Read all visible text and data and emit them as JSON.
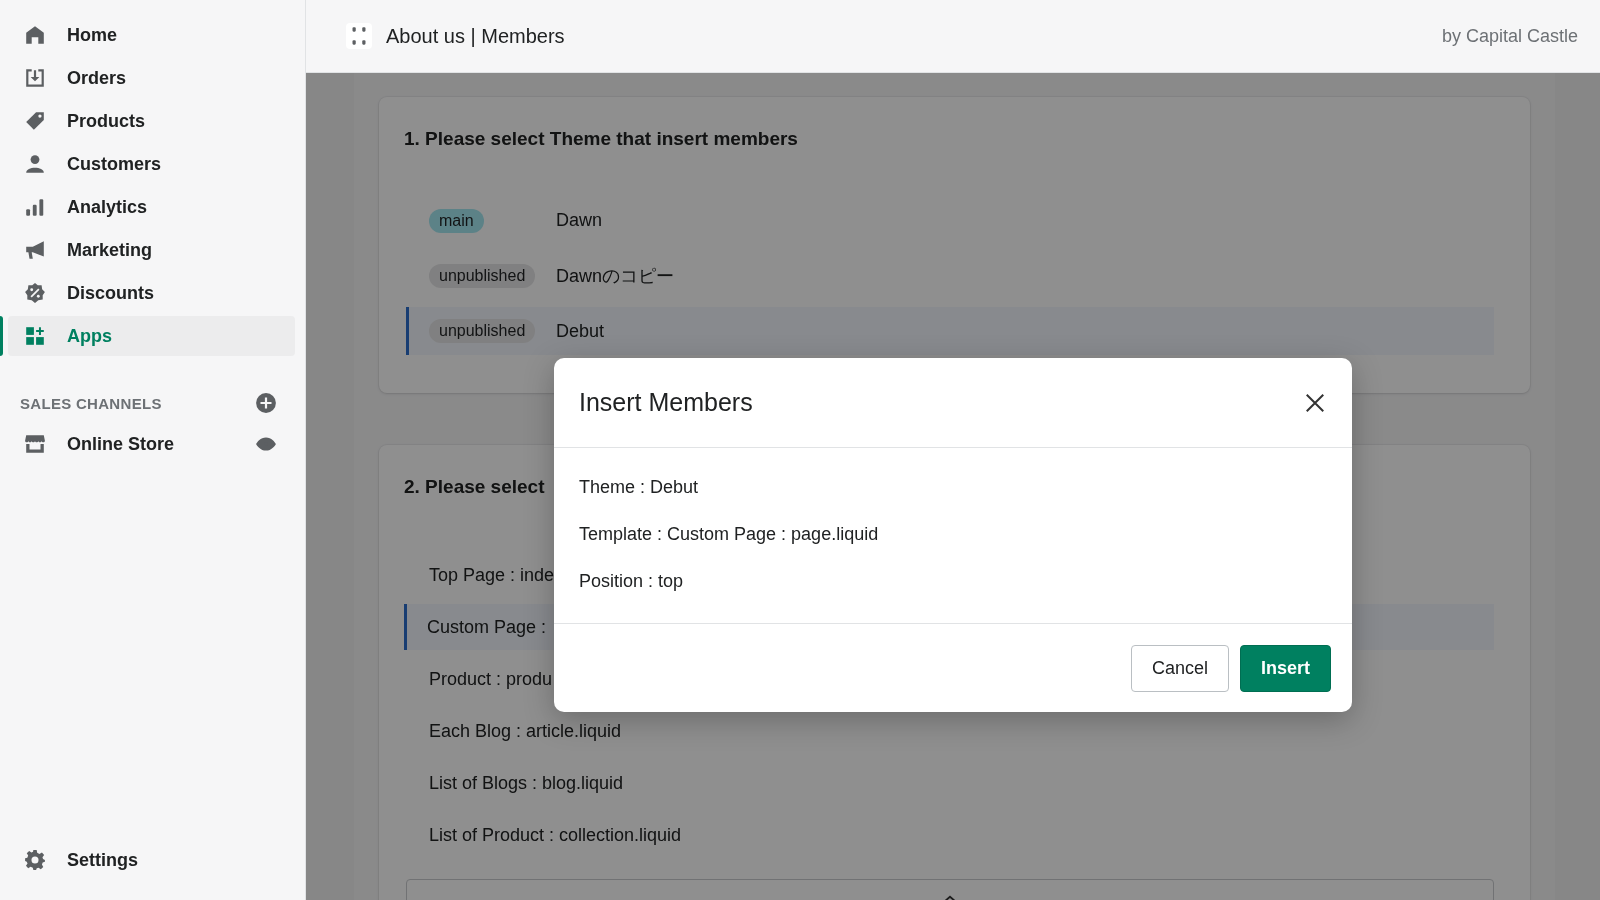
{
  "sidebar": {
    "items": [
      {
        "label": "Home",
        "selected": false
      },
      {
        "label": "Orders",
        "selected": false
      },
      {
        "label": "Products",
        "selected": false
      },
      {
        "label": "Customers",
        "selected": false
      },
      {
        "label": "Analytics",
        "selected": false
      },
      {
        "label": "Marketing",
        "selected": false
      },
      {
        "label": "Discounts",
        "selected": false
      },
      {
        "label": "Apps",
        "selected": true
      }
    ],
    "sales_channels": {
      "heading": "SALES CHANNELS",
      "items": [
        {
          "label": "Online Store"
        }
      ]
    },
    "settings": {
      "label": "Settings"
    }
  },
  "header": {
    "title": "About us | Members",
    "byline": "by Capital Castle"
  },
  "theme_section": {
    "title": "1. Please select Theme that insert members",
    "themes": [
      {
        "badge": "main",
        "color": "#5c8287",
        "name": "Dawn",
        "selected": false
      },
      {
        "badge": "unpublished",
        "color": "#808081",
        "name": "Dawnのコピー",
        "selected": false
      },
      {
        "badge": "unpublished",
        "color": "#808081",
        "name": "Debut",
        "selected": true
      }
    ]
  },
  "template_section": {
    "title": "2. Please select",
    "templates": [
      {
        "label": "Top Page : inde",
        "selected": false
      },
      {
        "label": "Custom Page :",
        "selected": true
      },
      {
        "label": "Product : produ",
        "selected": false
      },
      {
        "label": "Each Blog : article.liquid",
        "selected": false
      },
      {
        "label": "List of Blogs : blog.liquid",
        "selected": false
      },
      {
        "label": "List of Product : collection.liquid",
        "selected": false
      }
    ]
  },
  "modal": {
    "title": "Insert Members",
    "lines": [
      "Theme : Debut",
      "Template : Custom Page : page.liquid",
      "Position : top"
    ],
    "buttons": [
      {
        "label": "Cancel",
        "kind": "secondary"
      },
      {
        "label": "Insert",
        "kind": "primary"
      }
    ]
  }
}
